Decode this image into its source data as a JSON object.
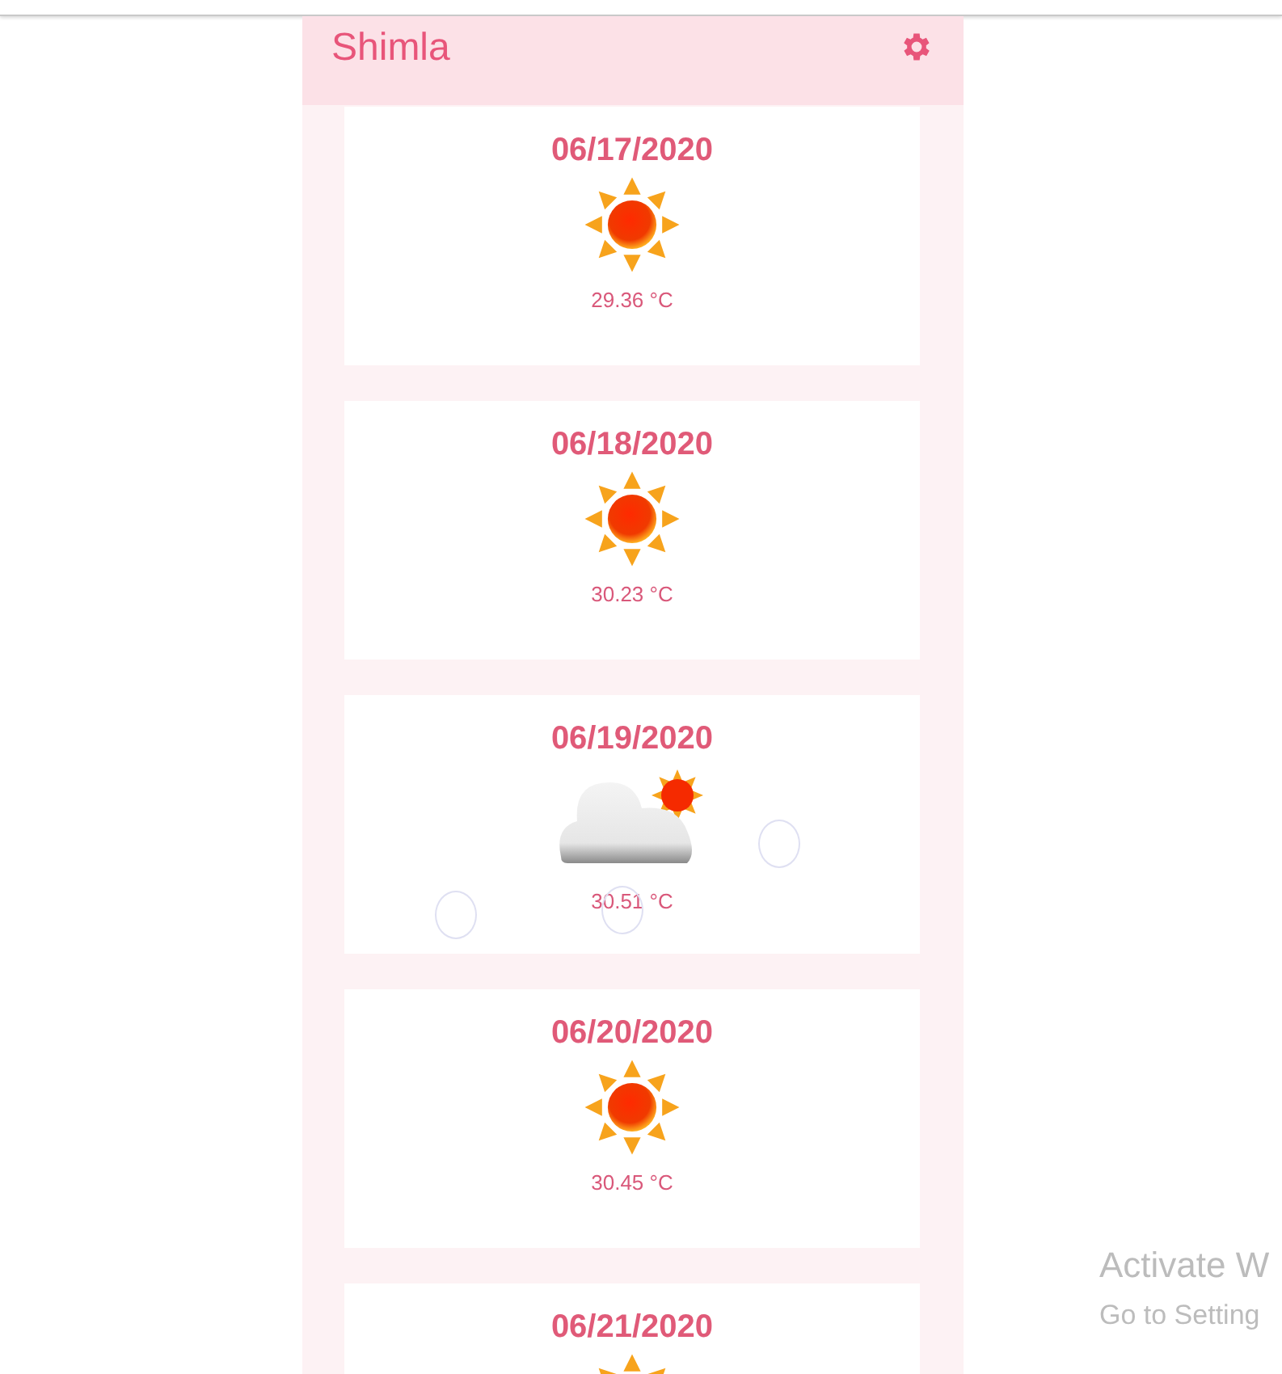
{
  "app_bar": {
    "title": "Shimla"
  },
  "forecast": [
    {
      "date": "06/17/2020",
      "kind": "sunny",
      "temperature": "29.36 °C"
    },
    {
      "date": "06/18/2020",
      "kind": "sunny",
      "temperature": "30.23 °C"
    },
    {
      "date": "06/19/2020",
      "kind": "partly-cloudy",
      "temperature": "30.51 °C"
    },
    {
      "date": "06/20/2020",
      "kind": "sunny",
      "temperature": "30.45 °C"
    },
    {
      "date": "06/21/2020",
      "kind": "sunny"
    }
  ],
  "os_notice": {
    "title": "Activate W",
    "subtitle": "Go to Setting"
  }
}
